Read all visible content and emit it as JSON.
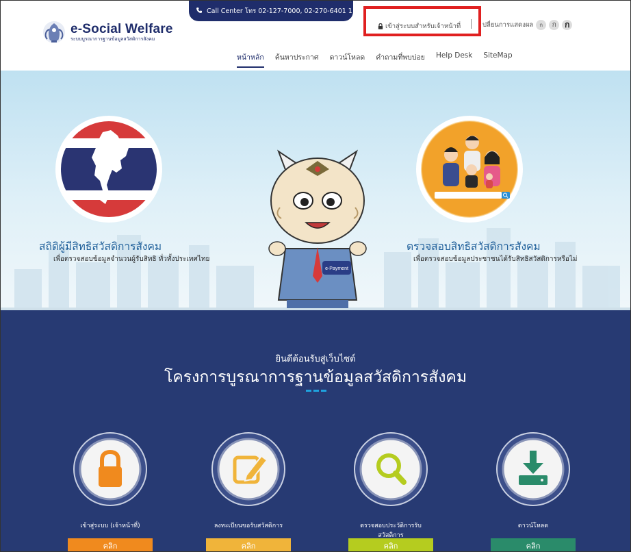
{
  "header": {
    "call_center": "Call Center โทร 02-127-7000, 02-270-6401 1",
    "logo_brand": "e-Social Welfare",
    "logo_sub": "ระบบบูรณาการฐานข้อมูลสวัสดิการสังคม",
    "login_link": "เข้าสู่ระบบสำหรับเจ้าหน้าที่",
    "display_label": "ปลี่ยนการแสดงผล",
    "font_sizes": [
      "ก",
      "ก",
      "ก"
    ],
    "highlight_color": "#e02020"
  },
  "nav": {
    "items": [
      "หน้าหลัก",
      "ค้นหาประกาศ",
      "ดาวน์โหลด",
      "คำถามที่พบบ่อย",
      "Help Desk",
      "SiteMap"
    ],
    "active_index": 0
  },
  "hero": {
    "left_title": "สถิติผู้มีสิทธิสวัสดิการสังคม",
    "left_sub": "เพื่อตรวจสอบข้อมูลจำนวนผู้รับสิทธิ ทั่วทั้งประเทศไทย",
    "right_title": "ตรวจสอบสิทธิสวัสดิการสังคม",
    "right_sub": "เพื่อตรวจสอบข้อมูลประชาชนได้รับสิทธิสวัสดิการหรือไม่",
    "mascot_badge": "e-Payment"
  },
  "welcome": {
    "small": "ยินดีต้อนรับสู่เว็บไซต์",
    "big": "โครงการบูรณาการฐานข้อมูลสวัสดิการสังคม"
  },
  "services": [
    {
      "label": "เข้าสู่ระบบ (เจ้าหน้าที่)",
      "button": "คลิก",
      "icon": "lock-icon",
      "color": "#f08a1e"
    },
    {
      "label": "ลงทะเบียนขอรับสวัสดิการ",
      "button": "คลิก",
      "icon": "edit-icon",
      "color": "#f0b43a"
    },
    {
      "label": "ตรวจสอบประวัติการรับสวัสดิการ",
      "button": "คลิก",
      "icon": "search-icon",
      "color": "#b5cc1f"
    },
    {
      "label": "ดาวน์โหลด",
      "button": "คลิก",
      "icon": "download-icon",
      "color": "#2a8b6a"
    }
  ]
}
